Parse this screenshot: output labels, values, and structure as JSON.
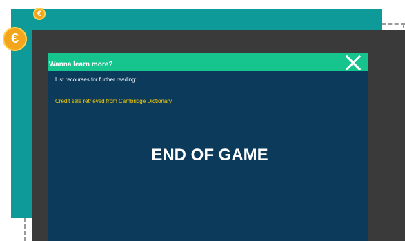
{
  "coins": {
    "small_symbol": "€",
    "large_symbol": "€"
  },
  "modal": {
    "title": "Wanna learn more?",
    "close_icon": "close-icon",
    "subtitle": "List recourses for further reading:",
    "link_text": "Credit sale retrieved from Cambridge Dictionary",
    "end_text": "END OF GAME"
  },
  "colors": {
    "teal_panel": "#0e9a98",
    "dark_panel": "#3a3a3a",
    "modal_bg": "#0b3a5b",
    "header_bg": "#16c48e",
    "link": "#ffd100",
    "coin": "#f3a51c"
  }
}
